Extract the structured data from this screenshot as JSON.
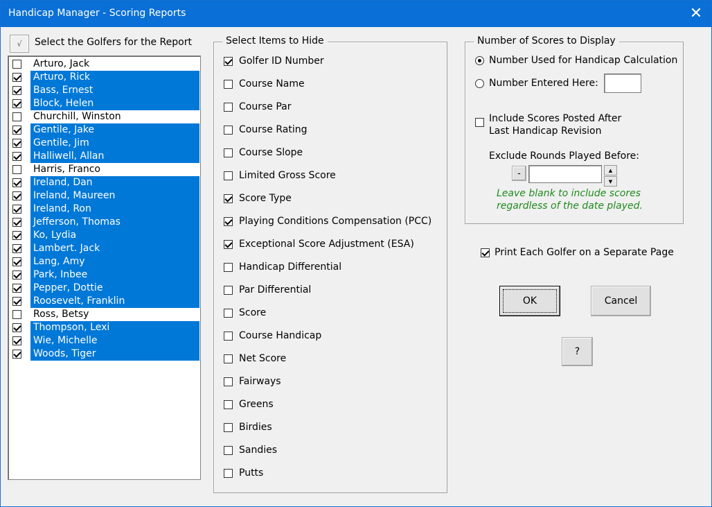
{
  "window": {
    "title": "Handicap Manager - Scoring Reports",
    "close_glyph": "✕"
  },
  "golfers": {
    "select_all_glyph": "√",
    "label": "Select the Golfers for the Report",
    "items": [
      {
        "name": "Arturo, Jack",
        "checked": false
      },
      {
        "name": "Arturo, Rick",
        "checked": true
      },
      {
        "name": "Bass, Ernest",
        "checked": true
      },
      {
        "name": "Block, Helen",
        "checked": true
      },
      {
        "name": "Churchill, Winston",
        "checked": false
      },
      {
        "name": "Gentile, Jake",
        "checked": true
      },
      {
        "name": "Gentile, Jim",
        "checked": true
      },
      {
        "name": "Halliwell, Allan",
        "checked": true
      },
      {
        "name": "Harris, Franco",
        "checked": false
      },
      {
        "name": "Ireland, Dan",
        "checked": true
      },
      {
        "name": "Ireland, Maureen",
        "checked": true
      },
      {
        "name": "Ireland, Ron",
        "checked": true
      },
      {
        "name": "Jefferson, Thomas",
        "checked": true
      },
      {
        "name": "Ko, Lydia",
        "checked": true
      },
      {
        "name": "Lambert. Jack",
        "checked": true
      },
      {
        "name": "Lang, Amy",
        "checked": true
      },
      {
        "name": "Park, Inbee",
        "checked": true
      },
      {
        "name": "Pepper, Dottie",
        "checked": true
      },
      {
        "name": "Roosevelt, Franklin",
        "checked": true
      },
      {
        "name": "Ross, Betsy",
        "checked": false
      },
      {
        "name": "Thompson, Lexi",
        "checked": true
      },
      {
        "name": "Wie, Michelle",
        "checked": true
      },
      {
        "name": "Woods, Tiger",
        "checked": true
      }
    ]
  },
  "hide_items": {
    "legend": "Select Items to Hide",
    "items": [
      {
        "label": "Golfer ID Number",
        "checked": true
      },
      {
        "label": "Course Name",
        "checked": false
      },
      {
        "label": "Course Par",
        "checked": false
      },
      {
        "label": "Course Rating",
        "checked": false
      },
      {
        "label": "Course Slope",
        "checked": false
      },
      {
        "label": "Limited Gross Score",
        "checked": false
      },
      {
        "label": "Score Type",
        "checked": true
      },
      {
        "label": "Playing Conditions Compensation (PCC)",
        "checked": true
      },
      {
        "label": "Exceptional Score Adjustment (ESA)",
        "checked": true
      },
      {
        "label": "Handicap Differential",
        "checked": false
      },
      {
        "label": "Par Differential",
        "checked": false
      },
      {
        "label": "Score",
        "checked": false
      },
      {
        "label": "Course Handicap",
        "checked": false
      },
      {
        "label": "Net Score",
        "checked": false
      },
      {
        "label": "Fairways",
        "checked": false
      },
      {
        "label": "Greens",
        "checked": false
      },
      {
        "label": "Birdies",
        "checked": false
      },
      {
        "label": "Sandies",
        "checked": false
      },
      {
        "label": "Putts",
        "checked": false
      }
    ]
  },
  "scores": {
    "legend": "Number of Scores to Display",
    "radio_used_label": "Number Used for Handicap Calculation",
    "radio_entered_label": "Number Entered Here:",
    "entered_value": "",
    "include_posted_line1": "Include Scores Posted After",
    "include_posted_line2": "Last Handicap Revision",
    "exclude_label": "Exclude Rounds Played Before:",
    "minus_label": "-",
    "date_value": "",
    "up_glyph": "▲",
    "down_glyph": "▼",
    "note_line1": "Leave blank to include scores",
    "note_line2": "regardless of the date played."
  },
  "print_separate_label": "Print Each Golfer on a Separate Page",
  "buttons": {
    "ok": "OK",
    "cancel": "Cancel",
    "help": "?"
  },
  "colors": {
    "title_bar": "#0a6fd6",
    "selection": "#0078d7",
    "note_text": "#1f8a1f"
  }
}
